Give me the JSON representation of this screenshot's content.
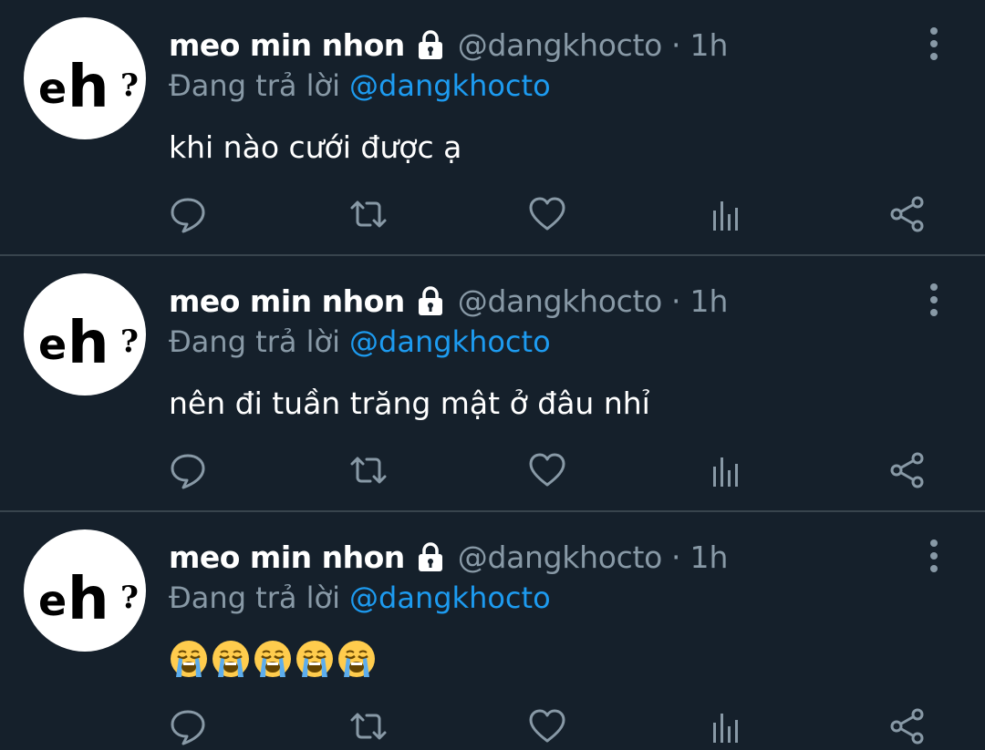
{
  "tweets": [
    {
      "author": {
        "name": "meo min nhon",
        "handle": "@dangkhocto",
        "separator": "·",
        "time": "1h",
        "avatar_text": "eh?"
      },
      "replying_label": "Đang trả lời",
      "replying_to": "@dangkhocto",
      "text": "khi nào cưới được ạ",
      "emoji": []
    },
    {
      "author": {
        "name": "meo min nhon",
        "handle": "@dangkhocto",
        "separator": "·",
        "time": "1h",
        "avatar_text": "eh?"
      },
      "replying_label": "Đang trả lời",
      "replying_to": "@dangkhocto",
      "text": "nên đi tuần trăng mật ở đâu nhỉ",
      "emoji": []
    },
    {
      "author": {
        "name": "meo min nhon",
        "handle": "@dangkhocto",
        "separator": "·",
        "time": "1h",
        "avatar_text": "eh?"
      },
      "replying_label": "Đang trả lời",
      "replying_to": "@dangkhocto",
      "text": "",
      "emoji": [
        "😭",
        "😭",
        "😭",
        "😭",
        "😭"
      ]
    }
  ],
  "icons": {
    "lock": "lock-icon",
    "more": "more-vertical-icon",
    "reply": "reply-icon",
    "retweet": "retweet-icon",
    "like": "heart-icon",
    "stats": "analytics-icon",
    "share": "share-icon",
    "emoji": "loudly-crying-face-emoji"
  },
  "colors": {
    "background": "#15202b",
    "divider": "#38444d",
    "primary_text": "#ffffff",
    "secondary_text": "#8899a6",
    "link": "#1d9bf0"
  }
}
